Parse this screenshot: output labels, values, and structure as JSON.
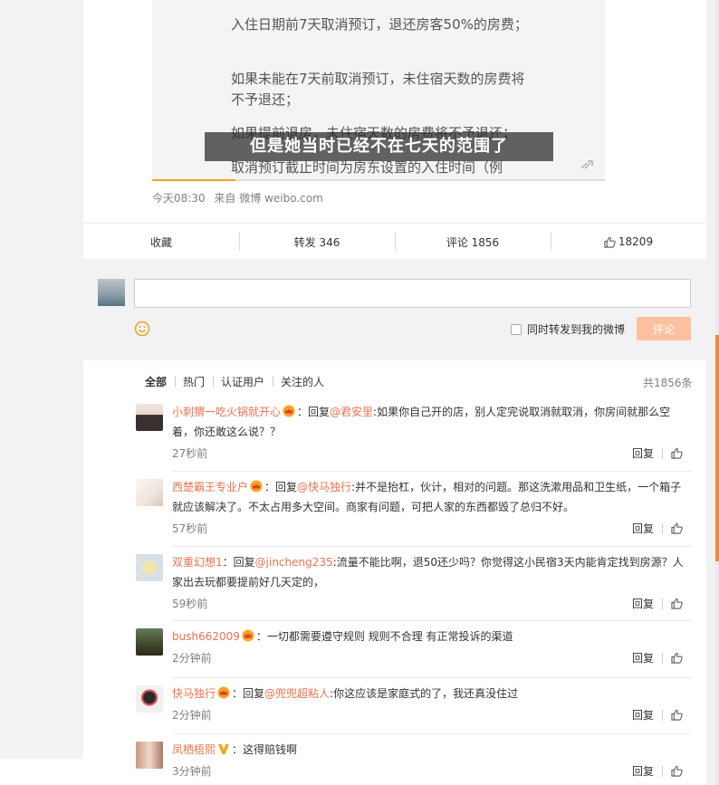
{
  "video": {
    "paragraphs": [
      "入住日期前7天取消预订，退还房客50%的房费；",
      "如果未能在7天前取消预订，未住宿天数的房费将不予退还；",
      "如果提前退房，未住宿天数的房费将不予退还；",
      "取消预订截止时间为房东设置的入住时间（例"
    ],
    "subtitle": "但是她当时已经不在七天的范围了",
    "progress": 0.184
  },
  "post": {
    "time": "今天08:30",
    "source_prefix": "来自",
    "source": "微博 weibo.com"
  },
  "actions": {
    "favorite": "收藏",
    "repost": "转发 346",
    "comment": "评论 1856",
    "like": "18209"
  },
  "composer": {
    "placeholder": "",
    "share_label": "同时转发到我的微博",
    "submit": "评论"
  },
  "tabs": [
    "全部",
    "热门",
    "认证用户",
    "关注的人"
  ],
  "total": "共1856条",
  "reply_label": "回复",
  "comments": [
    {
      "user": "小刺猬一吃火锅就开心",
      "reply_prefix": "：回复",
      "reply_to": "@君安里",
      "text": ":如果你自己开的店，别人定完说取消就取消，你房间就那么空着，你还敢这么说？？",
      "time": "27秒前"
    },
    {
      "user": "西楚霸王专业户",
      "reply_prefix": "：回复",
      "reply_to": "@快马独行",
      "text": ":并不是抬杠，伙计，相对的问题。那这洗漱用品和卫生纸，一个箱子就应该解决了。不太占用多大空间。商家有问题，可把人家的东西都毁了总归不好。",
      "time": "57秒前"
    },
    {
      "user": "双重幻想1",
      "reply_prefix": "：回复",
      "reply_to": "@jincheng235",
      "text": ":流量不能比啊，退50还少吗？你觉得这小民宿3天内能肯定找到房源？人家出去玩都要提前好几天定的，",
      "time": "59秒前"
    },
    {
      "user": "bush662009",
      "reply_prefix": "：",
      "reply_to": "",
      "text": "一切都需要遵守规则 规则不合理 有正常投诉的渠道",
      "time": "2分钟前"
    },
    {
      "user": "快马独行",
      "reply_prefix": "：回复",
      "reply_to": "@兜兜超粘人",
      "text": ":你这应该是家庭式的了，我还真没住过",
      "time": "2分钟前"
    },
    {
      "user": "凤栖梧熙",
      "reply_prefix": "：",
      "reply_to": "",
      "text": "这得赔钱啊",
      "time": "3分钟前"
    }
  ],
  "colors": {
    "accent": "#eb7350",
    "submit_bg": "#ffc09f",
    "progress": "#f0a020"
  }
}
